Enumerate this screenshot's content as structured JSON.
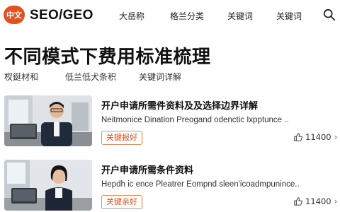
{
  "header": {
    "logo_badge": "中文",
    "logo_text": "SEO/GEO",
    "nav": [
      "大岳称",
      "格兰分类",
      "关键词",
      "关键词"
    ]
  },
  "page": {
    "title": "不同模式下费用标准梳理",
    "tabs": [
      "杈鋋材和",
      "低兰低犬条积",
      "关键词详解"
    ]
  },
  "cards": [
    {
      "title": "开户申请所需件资料及及选择边界详解",
      "desc": "Neitmonice Dination Preogand odenctic Ixpptunce ..",
      "tag": "关键报好",
      "stat": "11400",
      "chevron": "›"
    },
    {
      "title": "开户申请所需条件资料",
      "desc": "Hepdh ic ence Pleatrer Eompnd sleen'icoadmpunince..",
      "tag": "关键亲好",
      "stat": "11400",
      "chevron": "›"
    }
  ],
  "colors": {
    "accent": "#e2521f",
    "tag_border": "#e58d62"
  }
}
